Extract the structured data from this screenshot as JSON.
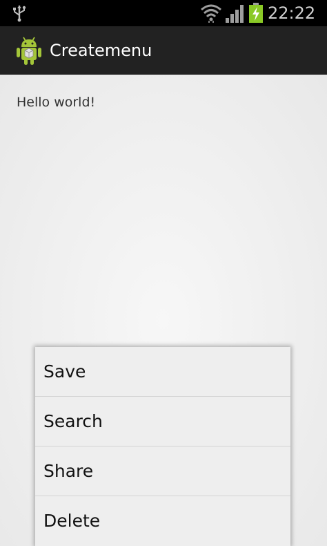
{
  "status_bar": {
    "time": "22:22",
    "icons": [
      "usb-icon",
      "wifi-icon",
      "signal-icon",
      "battery-charging-icon"
    ],
    "battery_color": "#8ac926"
  },
  "action_bar": {
    "title": "Createmenu",
    "icon": "android-app-icon",
    "icon_color": "#a4c639"
  },
  "content": {
    "text": "Hello world!"
  },
  "context_menu": {
    "items": [
      {
        "label": "Save"
      },
      {
        "label": "Search"
      },
      {
        "label": "Share"
      },
      {
        "label": "Delete"
      }
    ]
  }
}
